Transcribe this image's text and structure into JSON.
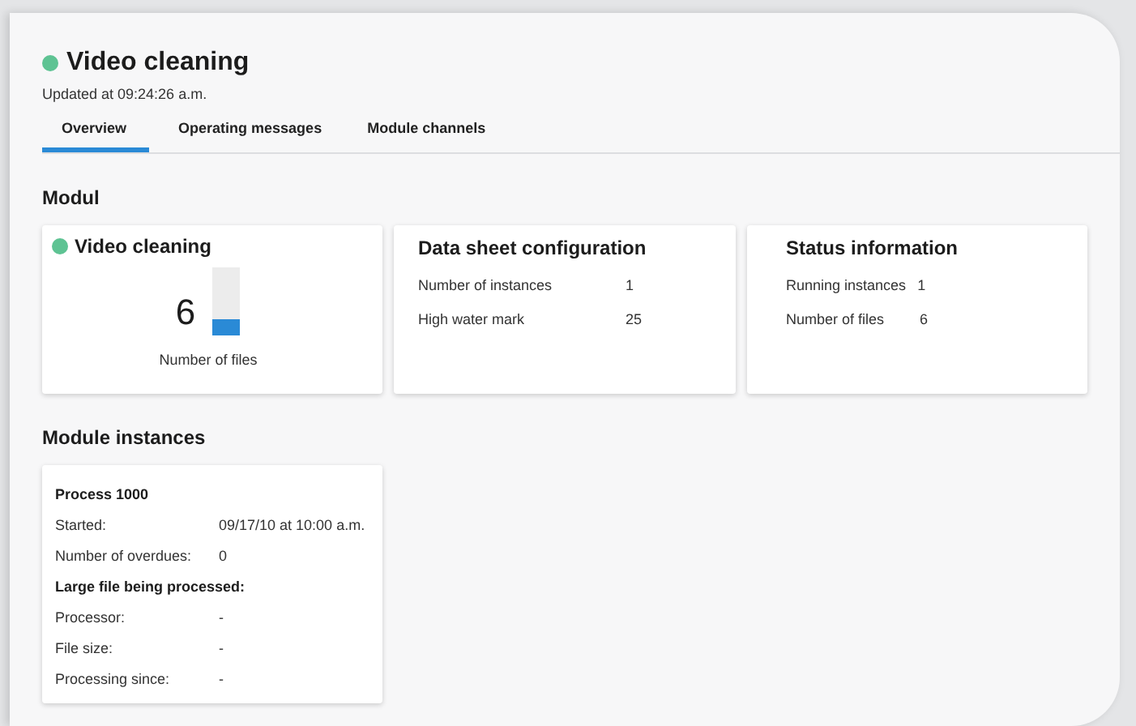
{
  "header": {
    "title": "Video cleaning",
    "color": "#5ec393",
    "updated": "Updated at 09:24:26 a.m."
  },
  "tabs": [
    {
      "label": "Overview",
      "selected": true
    },
    {
      "label": "Operating messages",
      "selected": false
    },
    {
      "label": "Module channels",
      "selected": false
    }
  ],
  "sections": [
    {
      "title": "Modul",
      "cards": [
        {
          "kind": "gauge",
          "title": "Video cleaning",
          "color": "#5ec393",
          "value": "6",
          "level": 0.25,
          "caption": "Number of files"
        },
        {
          "kind": "key_value",
          "title": "Data sheet configuration",
          "rows": [
            {
              "label": "Number of instances",
              "value": "1"
            },
            {
              "label": "High water mark",
              "value": "25"
            }
          ]
        },
        {
          "kind": "key_value",
          "title": "Status information",
          "rows": [
            {
              "label": "Running instances",
              "value": "1"
            },
            {
              "label": "Number of files",
              "value": "6"
            }
          ]
        }
      ]
    },
    {
      "title": "Module instances",
      "cards": [
        {
          "kind": "details",
          "items": [
            {
              "kind": "heading",
              "text": "Process 1000"
            },
            {
              "kind": "row",
              "label": "Started:",
              "value": "09/17/10 at 10:00 a.m."
            },
            {
              "kind": "row",
              "label": "Number of overdues:",
              "value": "0"
            },
            {
              "kind": "heading",
              "text": "Large file being processed:"
            },
            {
              "kind": "row",
              "label": "Processor:",
              "value": "-"
            },
            {
              "kind": "row",
              "label": "File size:",
              "value": "-"
            },
            {
              "kind": "row",
              "label": "Processing since:",
              "value": "-"
            }
          ]
        }
      ]
    }
  ]
}
